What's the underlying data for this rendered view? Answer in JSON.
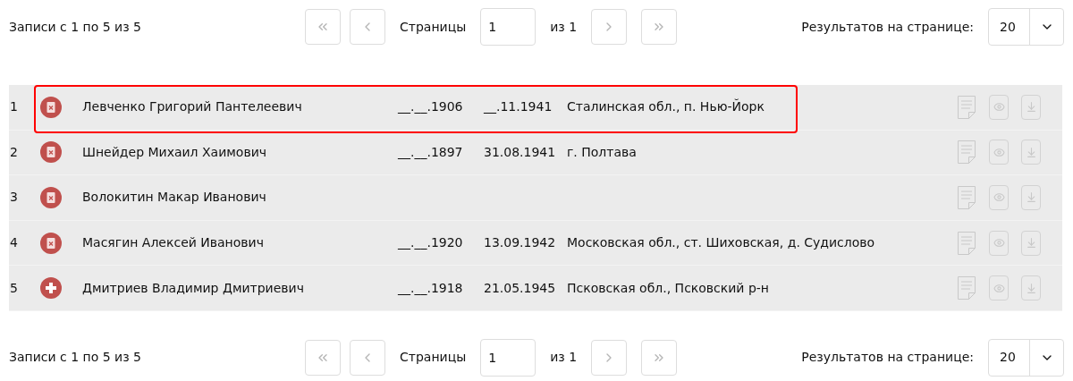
{
  "pagers": [
    {
      "summary": "Записи с 1 по 5 из 5",
      "first_disabled": true,
      "prev_disabled": true,
      "pages_label": "Страницы",
      "page": "1",
      "of_label": "из 1",
      "next_disabled": true,
      "last_disabled": true,
      "per_page_label": "Результатов на странице:",
      "per_page": "20"
    },
    {
      "summary": "Записи с 1 по 5 из 5",
      "first_disabled": true,
      "prev_disabled": true,
      "pages_label": "Страницы",
      "page": "1",
      "of_label": "из 1",
      "next_disabled": true,
      "last_disabled": true,
      "per_page_label": "Результатов на странице:",
      "per_page": "20"
    }
  ],
  "rows": [
    {
      "number": "1",
      "kind": "doc-x",
      "name": "Левченко Григорий Пантелеевич",
      "birth": "__.__.1906",
      "death": "__.11.1941",
      "place": "Сталинская обл., п. Нью-Йорк",
      "highlighted": true
    },
    {
      "number": "2",
      "kind": "doc-x",
      "name": "Шнейдер Михаил Хаимович",
      "birth": "__.__.1897",
      "death": "31.08.1941",
      "place": "г. Полтава",
      "highlighted": false
    },
    {
      "number": "3",
      "kind": "doc-x",
      "name": "Волокитин Макар Иванович",
      "highlighted": false
    },
    {
      "number": "4",
      "kind": "doc-x",
      "name": "Масягин Алексей Иванович",
      "birth": "__.__.1920",
      "death": "13.09.1942",
      "place": "Московская обл., ст. Шиховская, д. Судислово",
      "highlighted": false
    },
    {
      "number": "5",
      "kind": "cross",
      "name": "Дмитриев Владимир Дмитриевич",
      "birth": "__.__.1918",
      "death": "21.05.1945",
      "place": "Псковская обл., Псковский р-н",
      "highlighted": false
    }
  ]
}
